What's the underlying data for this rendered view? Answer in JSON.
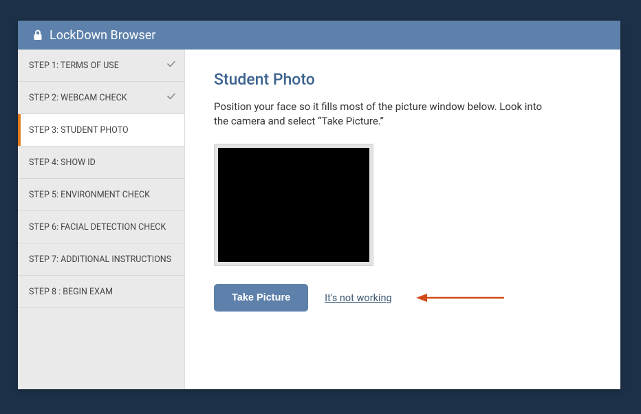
{
  "header": {
    "title": "LockDown Browser"
  },
  "sidebar": {
    "items": [
      {
        "label": "STEP 1: TERMS OF USE",
        "completed": true
      },
      {
        "label": "STEP 2: WEBCAM CHECK",
        "completed": true
      },
      {
        "label": "STEP 3: STUDENT PHOTO",
        "completed": false,
        "active": true
      },
      {
        "label": "STEP 4: SHOW ID",
        "completed": false
      },
      {
        "label": "STEP 5: ENVIRONMENT CHECK",
        "completed": false
      },
      {
        "label": "STEP 6: FACIAL DETECTION CHECK",
        "completed": false
      },
      {
        "label": "STEP 7: ADDITIONAL INSTRUCTIONS",
        "completed": false
      },
      {
        "label": "STEP 8 : BEGIN EXAM",
        "completed": false
      }
    ]
  },
  "main": {
    "title": "Student Photo",
    "instructions": "Position your face so it fills most of the picture window below. Look into the camera and select “Take Picture.”",
    "take_picture_label": "Take Picture",
    "not_working_label": "It's not working"
  },
  "colors": {
    "header_bg": "#5d81ab",
    "accent": "#e07b1a",
    "annotation_arrow": "#d14a17"
  }
}
